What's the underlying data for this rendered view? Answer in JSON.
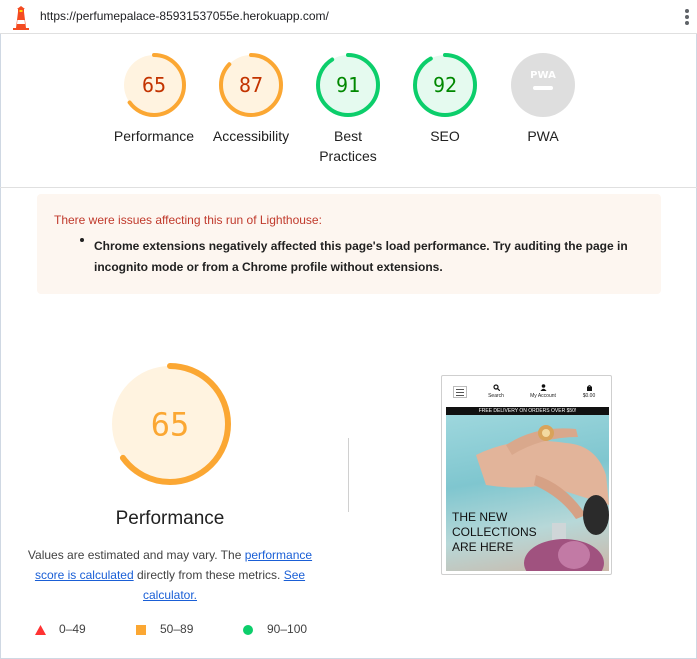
{
  "topbar": {
    "url": "https://perfumepalace-85931537055e.herokuapp.com/"
  },
  "colors": {
    "orange": "#fba733",
    "orange_text": "#c33300",
    "orange_bg": "#fff3e0",
    "green": "#0cce6b",
    "green_text": "#008800",
    "green_bg": "#e5faef",
    "red": "#ff3333",
    "grey": "#dedede",
    "link": "#1a5fd6"
  },
  "gauges": [
    {
      "label": "Performance",
      "score": "65",
      "value": 65,
      "rating": "average"
    },
    {
      "label": "Accessibility",
      "score": "87",
      "value": 87,
      "rating": "average"
    },
    {
      "label": "Best Practices",
      "score": "91",
      "value": 91,
      "rating": "pass"
    },
    {
      "label": "SEO",
      "score": "92",
      "value": 92,
      "rating": "pass"
    },
    {
      "label": "PWA",
      "score": "PWA",
      "value": null,
      "rating": "na"
    }
  ],
  "warning": {
    "title": "There were issues affecting this run of Lighthouse:",
    "items": [
      "Chrome extensions negatively affected this page's load performance. Try auditing the page in incognito mode or from a Chrome profile without extensions."
    ]
  },
  "performance": {
    "score": "65",
    "value": 65,
    "title": "Performance",
    "desc_prefix": "Values are estimated and may vary. The ",
    "link1": "performance score is calculated",
    "desc_middle": " directly from these metrics. ",
    "link2": "See calculator."
  },
  "legend": [
    {
      "shape": "triangle",
      "range": "0–49"
    },
    {
      "shape": "square",
      "range": "50–89"
    },
    {
      "shape": "circle",
      "range": "90–100"
    }
  ],
  "phone_preview": {
    "nav": [
      "Search",
      "My Account",
      "$0.00"
    ],
    "banner": "FREE DELIVERY ON ORDERS OVER $50!",
    "hero_lines": [
      "THE NEW",
      "COLLECTIONS",
      "ARE HERE"
    ]
  }
}
